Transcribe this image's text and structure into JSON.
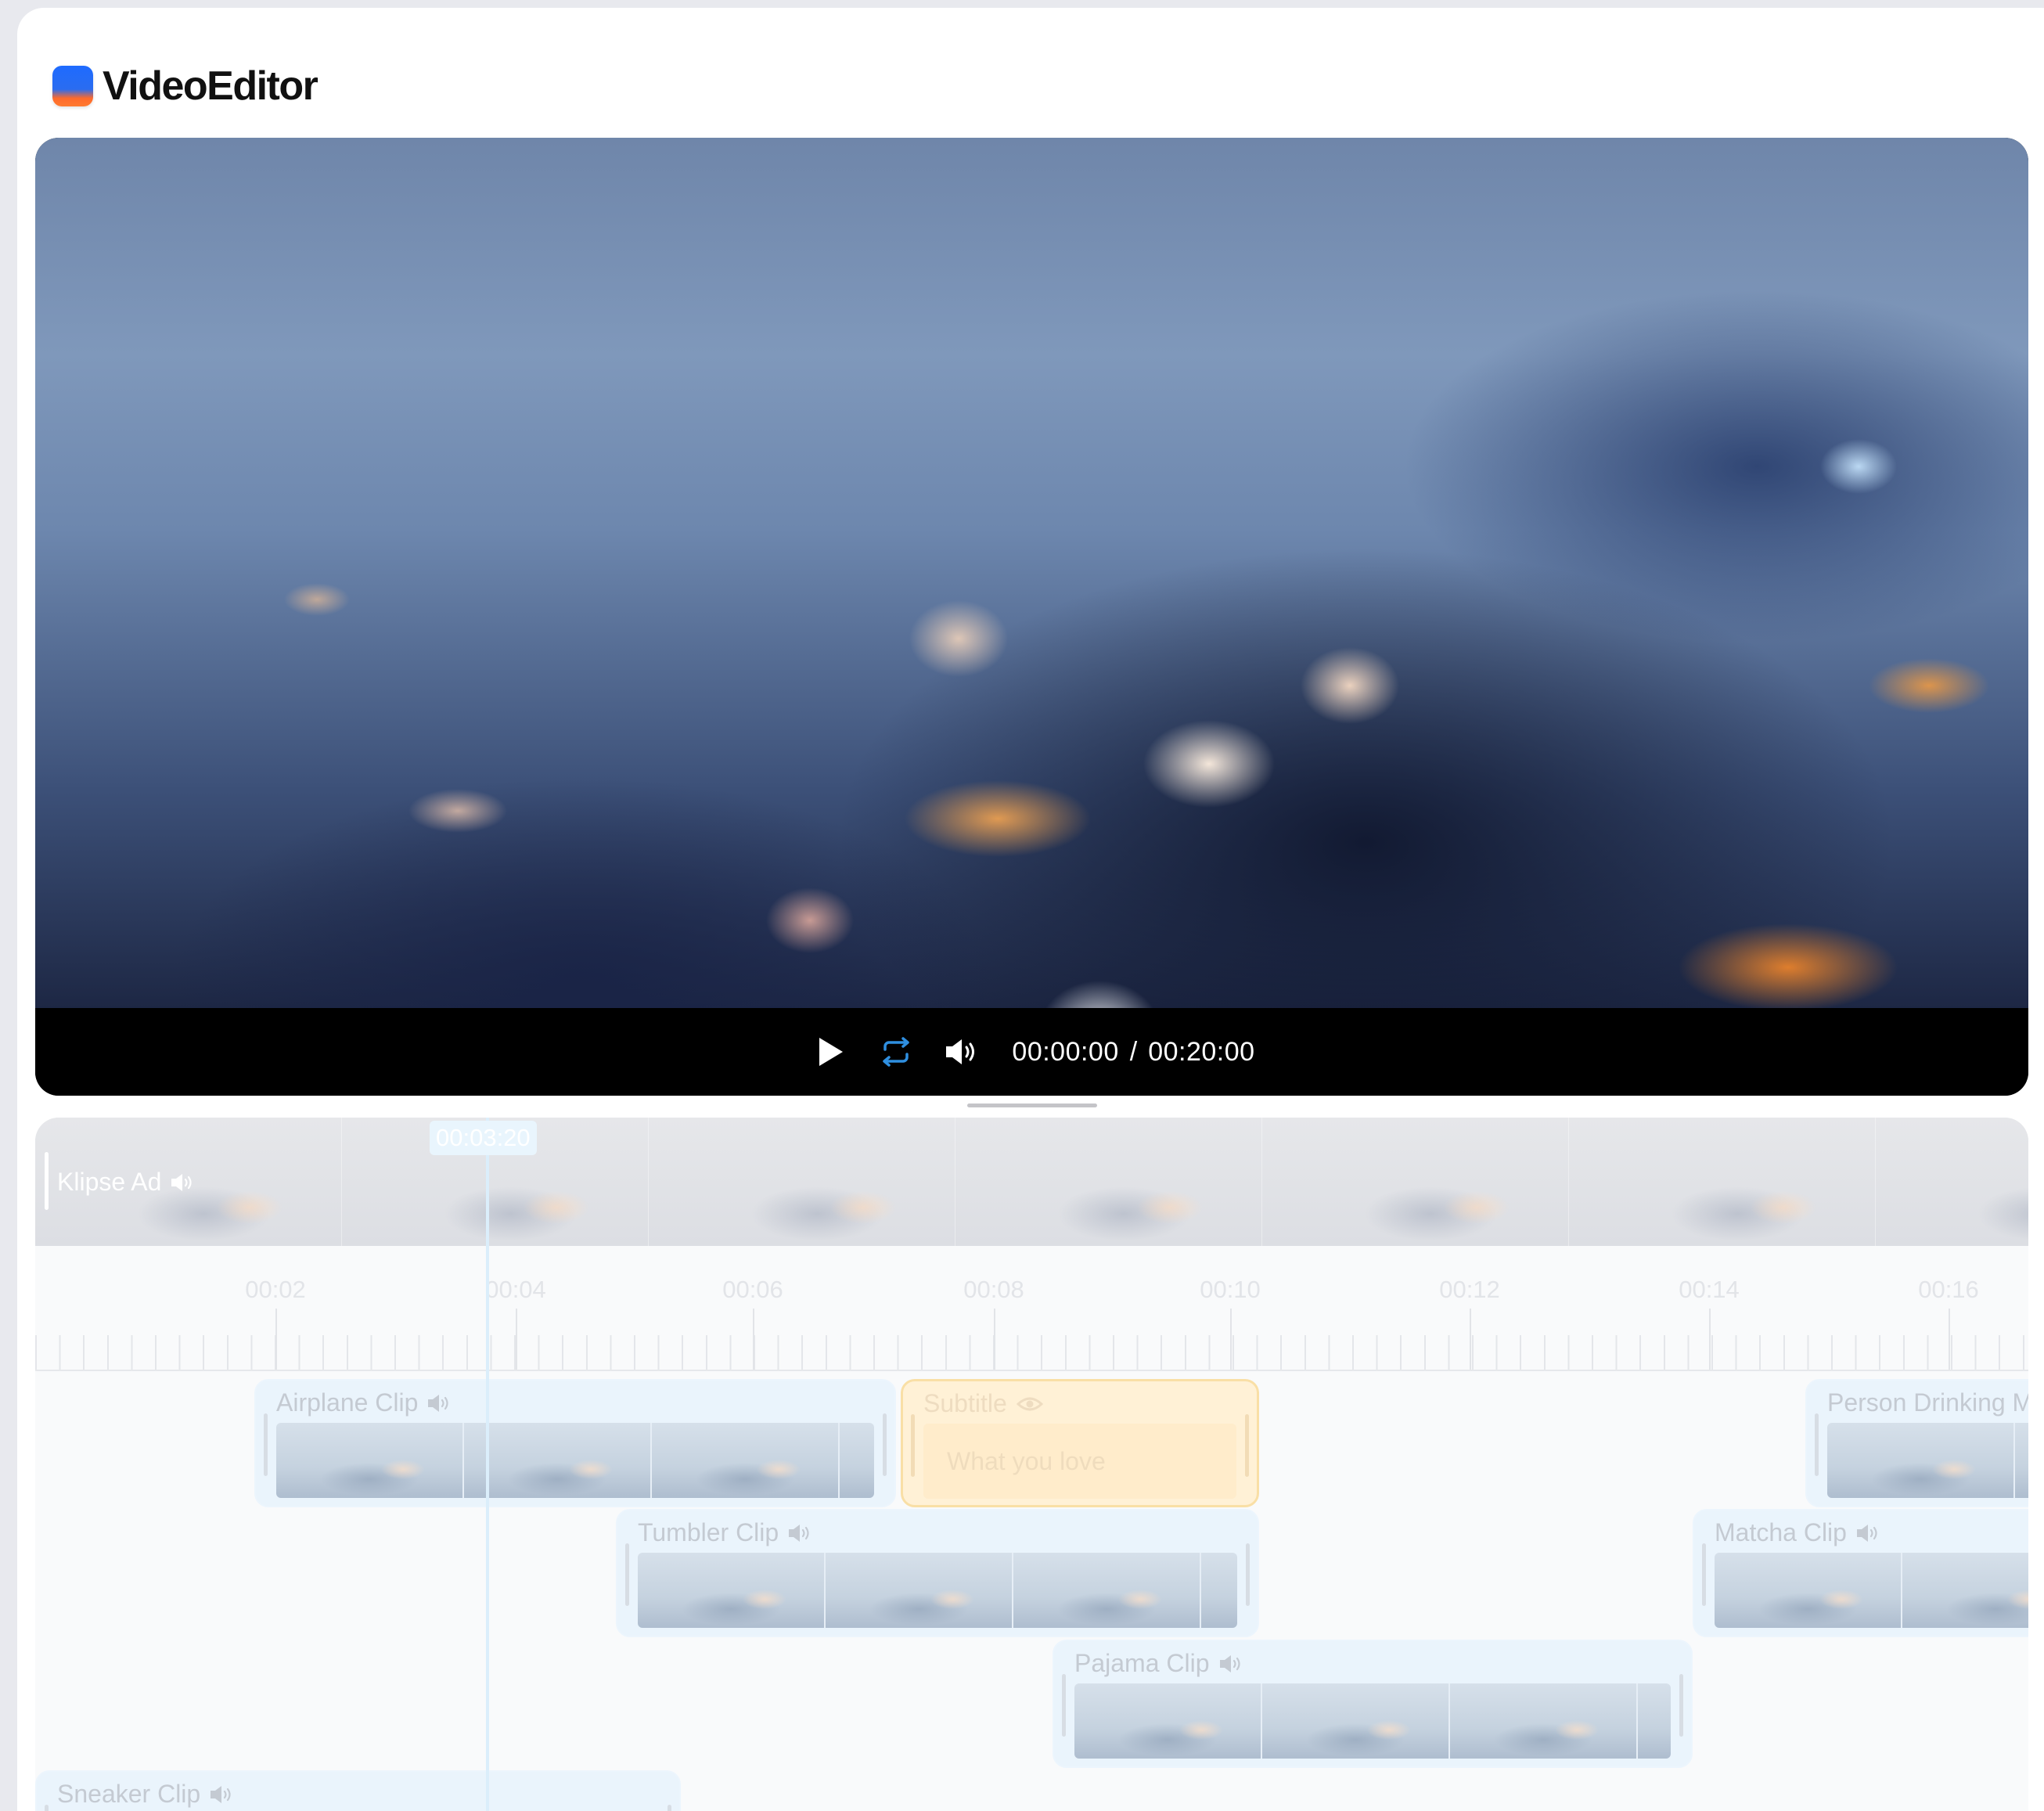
{
  "app": {
    "brand": "VideoEditor"
  },
  "player": {
    "current_time": "00:00:00",
    "separator": "/",
    "total_time": "00:20:00",
    "controls": [
      "play-icon",
      "loop-icon",
      "volume-icon"
    ],
    "accent_color": "#2f8fe0"
  },
  "timeline": {
    "playhead_time": "00:03:20",
    "master_track": {
      "label": "Klipse Ad",
      "icon": "volume-icon"
    },
    "ruler": [
      "00:02",
      "00:04",
      "00:06",
      "00:08",
      "00:10",
      "00:12",
      "00:14",
      "00:16"
    ],
    "clips": {
      "airplane": {
        "label": "Airplane Clip",
        "icon": "volume-icon"
      },
      "subtitle": {
        "label": "Subtitle",
        "icon": "eye-icon",
        "text": "What you love"
      },
      "person": {
        "label": "Person Drinking M",
        "icon": "volume-icon"
      },
      "tumbler": {
        "label": "Tumbler Clip",
        "icon": "volume-icon"
      },
      "matcha": {
        "label": "Matcha Clip",
        "icon": "volume-icon"
      },
      "pajama": {
        "label": "Pajama Clip",
        "icon": "volume-icon"
      },
      "sneaker": {
        "label": "Sneaker Clip",
        "icon": "volume-icon"
      }
    }
  }
}
